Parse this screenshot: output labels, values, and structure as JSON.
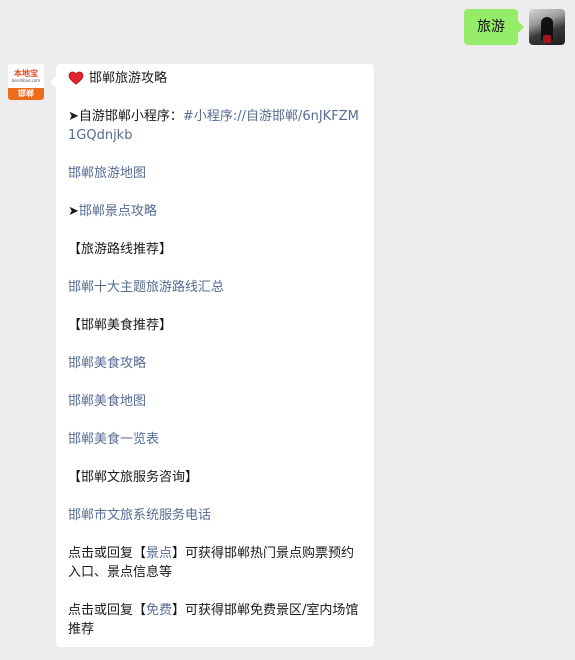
{
  "user_message": {
    "text": "旅游"
  },
  "bot_message": {
    "title": "邯郸旅游攻略",
    "mini_program": {
      "arrow": "➤",
      "label": "自游邯郸小程序：",
      "link": "#小程序://自游邯郸/6nJKFZM1GQdnjkb"
    },
    "travel_map": "邯郸旅游地图",
    "scenic_guide": {
      "arrow": "➤",
      "link": "邯郸景点攻略"
    },
    "route_heading": "【旅游路线推荐】",
    "route_link": "邯郸十大主题旅游路线汇总",
    "food_heading": "【邯郸美食推荐】",
    "food_links": [
      "邯郸美食攻略",
      "邯郸美食地图",
      "邯郸美食一览表"
    ],
    "culture_heading": "【邯郸文旅服务咨询】",
    "culture_link": "邯郸市文旅系统服务电话",
    "reply_scenic": {
      "prefix": "点击或回复【",
      "keyword": "景点",
      "suffix": "】可获得邯郸热门景点购票预约入口、景点信息等"
    },
    "reply_free": {
      "prefix": "点击或回复【",
      "keyword": "免费",
      "suffix": "】可获得邯郸免费景区/室内场馆推荐"
    }
  },
  "bot_avatar": {
    "brand": "本地宝",
    "site": "bendibao.com",
    "city": "邯郸"
  },
  "colors": {
    "background": "#ededed",
    "user_bubble": "#95ec69",
    "bot_bubble": "#ffffff",
    "link": "#576b95",
    "heart": "#e0242a"
  },
  "icons": {
    "heart": "heart-icon"
  }
}
